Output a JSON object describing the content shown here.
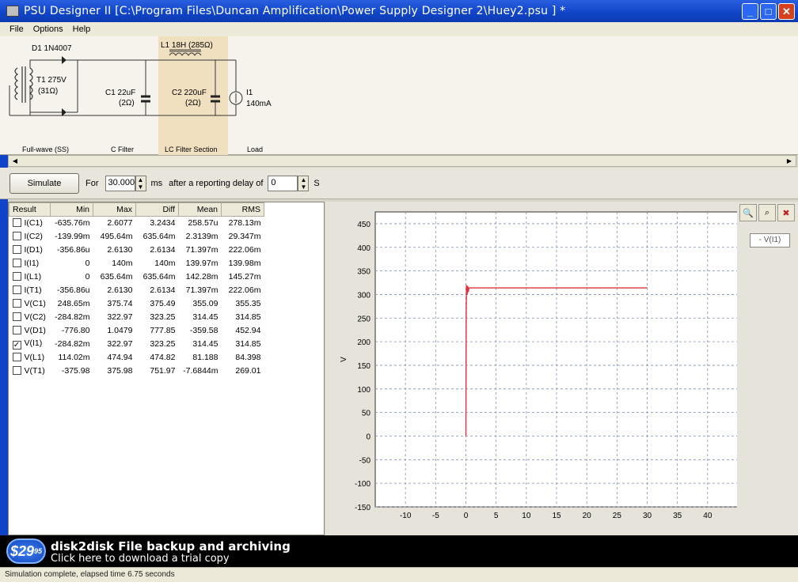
{
  "window": {
    "title": "PSU Designer II  [C:\\Program Files\\Duncan Amplification\\Power Supply Designer 2\\Huey2.psu ] *"
  },
  "menu": [
    "File",
    "Options",
    "Help"
  ],
  "schematic": {
    "diode_label": "D1 1N4007",
    "transformer_label_1": "T1 275V",
    "transformer_label_2": "(31Ω)",
    "c1_label_1": "C1 22uF",
    "c1_label_2": "(2Ω)",
    "inductor_label": "L1 18H (285Ω)",
    "c2_label_1": "C2 220uF",
    "c2_label_2": "(2Ω)",
    "load_label_1": "I1",
    "load_label_2": "140mA",
    "section_fullwave": "Full-wave (SS)",
    "section_cfilter": "C Filter",
    "section_lcfilter": "LC Filter Section",
    "section_load": "Load"
  },
  "simbar": {
    "simulate_label": "Simulate",
    "for_label": "For",
    "duration_value": "30.000",
    "ms_label": "ms",
    "delay_label": "after a reporting delay of",
    "delay_value": "0",
    "s_label": "S"
  },
  "results": {
    "headers": [
      "Result",
      "Min",
      "Max",
      "Diff",
      "Mean",
      "RMS"
    ],
    "rows": [
      {
        "name": "I(C1)",
        "checked": false,
        "min": "-635.76m",
        "max": "2.6077",
        "diff": "3.2434",
        "mean": "258.57u",
        "rms": "278.13m"
      },
      {
        "name": "I(C2)",
        "checked": false,
        "min": "-139.99m",
        "max": "495.64m",
        "diff": "635.64m",
        "mean": "2.3139m",
        "rms": "29.347m"
      },
      {
        "name": "I(D1)",
        "checked": false,
        "min": "-356.86u",
        "max": "2.6130",
        "diff": "2.6134",
        "mean": "71.397m",
        "rms": "222.06m"
      },
      {
        "name": "I(I1)",
        "checked": false,
        "min": "0",
        "max": "140m",
        "diff": "140m",
        "mean": "139.97m",
        "rms": "139.98m"
      },
      {
        "name": "I(L1)",
        "checked": false,
        "min": "0",
        "max": "635.64m",
        "diff": "635.64m",
        "mean": "142.28m",
        "rms": "145.27m"
      },
      {
        "name": "I(T1)",
        "checked": false,
        "min": "-356.86u",
        "max": "2.6130",
        "diff": "2.6134",
        "mean": "71.397m",
        "rms": "222.06m"
      },
      {
        "name": "V(C1)",
        "checked": false,
        "min": "248.65m",
        "max": "375.74",
        "diff": "375.49",
        "mean": "355.09",
        "rms": "355.35"
      },
      {
        "name": "V(C2)",
        "checked": false,
        "min": "-284.82m",
        "max": "322.97",
        "diff": "323.25",
        "mean": "314.45",
        "rms": "314.85"
      },
      {
        "name": "V(D1)",
        "checked": false,
        "min": "-776.80",
        "max": "1.0479",
        "diff": "777.85",
        "mean": "-359.58",
        "rms": "452.94"
      },
      {
        "name": "V(I1)",
        "checked": true,
        "min": "-284.82m",
        "max": "322.97",
        "diff": "323.25",
        "mean": "314.45",
        "rms": "314.85"
      },
      {
        "name": "V(L1)",
        "checked": false,
        "min": "114.02m",
        "max": "474.94",
        "diff": "474.82",
        "mean": "81.188",
        "rms": "84.398"
      },
      {
        "name": "V(T1)",
        "checked": false,
        "min": "-375.98",
        "max": "375.98",
        "diff": "751.97",
        "mean": "-7.6844m",
        "rms": "269.01"
      }
    ]
  },
  "graph": {
    "legend": "- V(I1)",
    "icons": [
      "zoom-in-icon",
      "zoom-fit-icon",
      "zoom-reset-icon"
    ]
  },
  "chart_data": {
    "type": "line",
    "ylabel": "V",
    "xlim": [
      -15,
      45
    ],
    "ylim": [
      -150,
      475
    ],
    "xticks": [
      -10,
      -5,
      0,
      5,
      10,
      15,
      20,
      25,
      30,
      35,
      40
    ],
    "yticks": [
      -150,
      -100,
      -50,
      0,
      50,
      100,
      150,
      200,
      250,
      300,
      350,
      400,
      450
    ],
    "grid": true,
    "series": [
      {
        "name": "V(I1)",
        "color": "#e0303a",
        "x": [
          0,
          0.05,
          0.1,
          0.15,
          0.2,
          0.3,
          0.4,
          0.5,
          1,
          5,
          10,
          20,
          30
        ],
        "y": [
          0,
          260,
          320,
          310,
          300,
          318,
          305,
          314,
          314,
          314,
          314,
          314,
          314
        ]
      }
    ]
  },
  "ad": {
    "price": "$29",
    "price_cents": "95",
    "title": "disk2disk File backup and archiving",
    "link": "Click here to download a trial copy"
  },
  "status": {
    "text": "Simulation complete, elapsed time 6.75 seconds"
  },
  "colors": {
    "titlebar": "#1044c8",
    "trace": "#e0303a",
    "lc_highlight": "#f0e0c0"
  }
}
